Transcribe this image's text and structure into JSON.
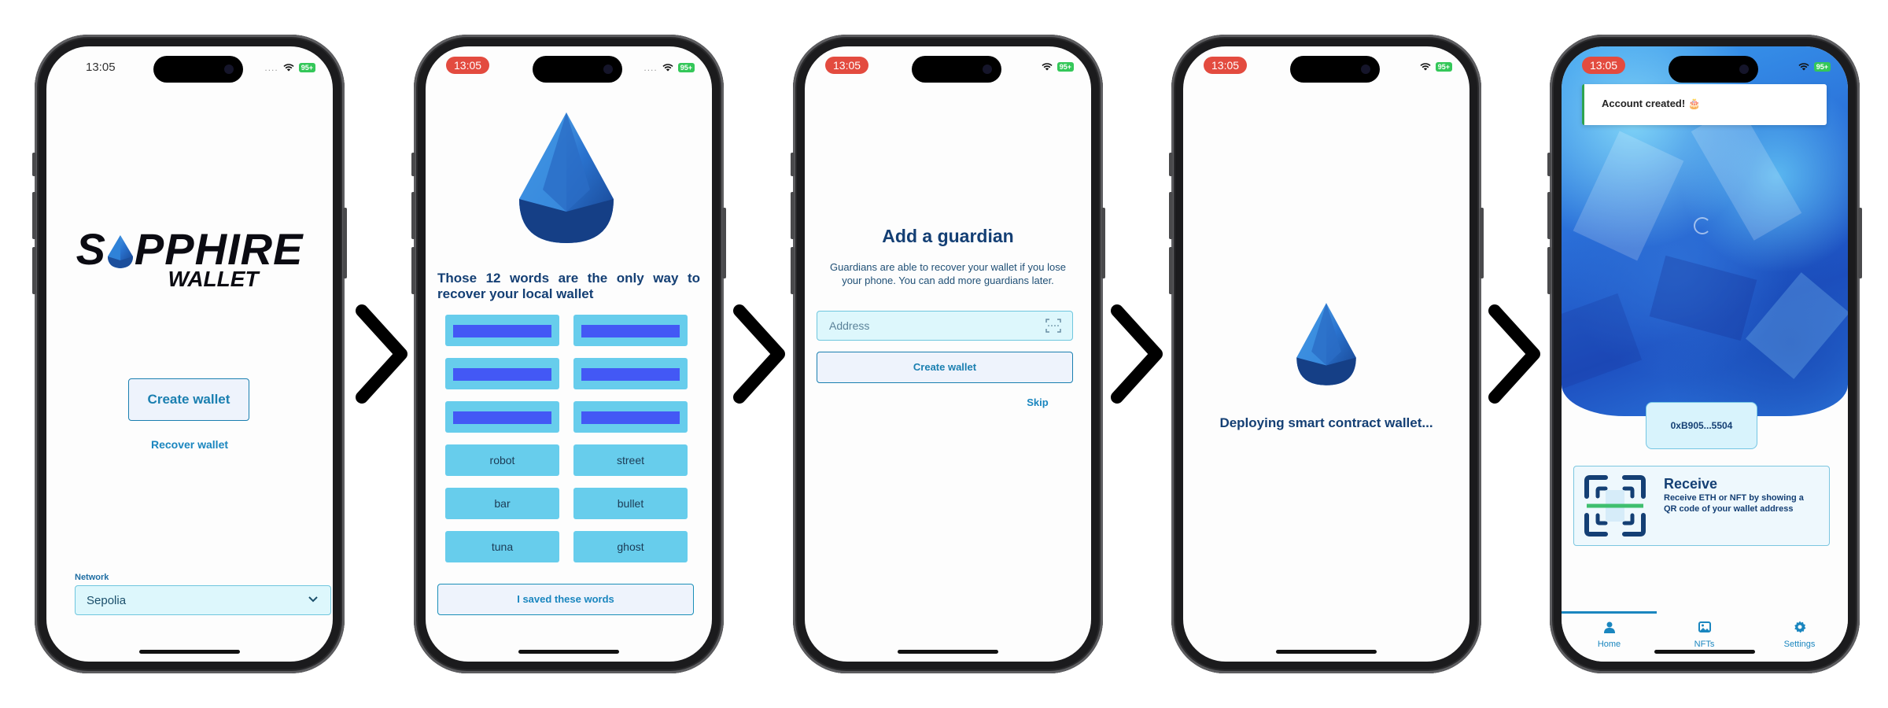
{
  "status_bar": {
    "time": "13:05",
    "battery": "95+"
  },
  "screen1": {
    "logo_line1_a": "S",
    "logo_line1_b": "PPHIRE",
    "logo_line2": "WALLET",
    "create_button": "Create wallet",
    "recover_link": "Recover wallet",
    "network_label": "Network",
    "network_value": "Sepolia"
  },
  "screen2": {
    "heading": "Those 12 words are the only way to recover your local wallet",
    "words": [
      "robot",
      "street",
      "bar",
      "bullet",
      "tuna",
      "ghost"
    ],
    "saved_button": "I saved these words"
  },
  "screen3": {
    "title": "Add a guardian",
    "description": "Guardians are able to recover your wallet if you lose your phone. You can add more guardians later.",
    "address_placeholder": "Address",
    "create_button": "Create wallet",
    "skip_link": "Skip"
  },
  "screen4": {
    "status_text": "Deploying smart contract wallet..."
  },
  "screen5": {
    "toast": "Account created! 🎂",
    "address_short": "0xB905...5504",
    "receive_title": "Receive",
    "receive_desc": "Receive ETH or NFT by showing a QR code of your wallet address",
    "tabs": [
      "Home",
      "NFTs",
      "Settings"
    ]
  },
  "colors": {
    "brand_blue": "#143f74",
    "link_blue": "#1a86bf",
    "cell_cyan": "#67cdec",
    "mask_blue": "#4358f5",
    "status_red": "#e34b3f",
    "battery_green": "#34c759"
  }
}
